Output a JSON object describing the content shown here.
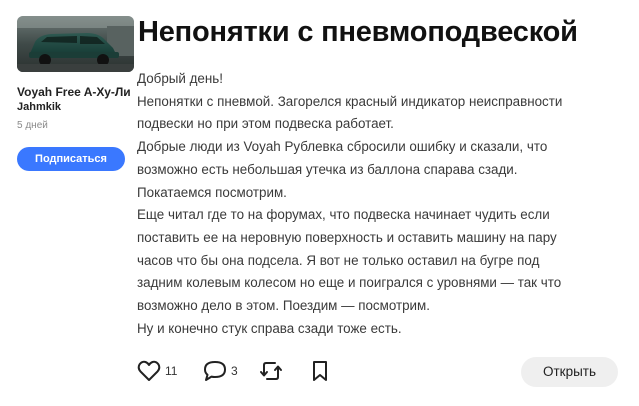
{
  "sidebar": {
    "car_name": "Voyah Free A-Ху-Ли",
    "author": "Jahmkik",
    "age": "5 дней",
    "subscribe_label": "Подписаться"
  },
  "post": {
    "title": "Непонятки с пневмоподвеской",
    "lines": [
      "Добрый день!",
      "Непонятки с пневмой. Загорелся красный индикатор неисправности",
      "подвески но при этом подвеска работает.",
      "Добрые люди из Voyah Рублевка сбросили ошибку и сказали, что",
      "возможно есть небольшая утечка из баллона спарава сзади.",
      "Покатаемся посмотрим.",
      "Еще читал где то на форумах, что подвеска начинает чудить если",
      "поставить ее на неровную поверхность и оставить машину на пару",
      "часов что бы она подсела. Я вот не только оставил на бугре под",
      "задним колевым колесом но еще и поигрался с уровнями — так что",
      "возможно дело в этом. Поездим — посмотрим.",
      "Ну и конечно стук справа сзади тоже есть."
    ]
  },
  "actions": {
    "likes": "11",
    "comments": "3",
    "open_label": "Открыть"
  },
  "colors": {
    "accent": "#3a78ff",
    "button_bg": "#efefef"
  },
  "icons": [
    "heart-icon",
    "comment-icon",
    "repost-icon",
    "bookmark-icon"
  ]
}
